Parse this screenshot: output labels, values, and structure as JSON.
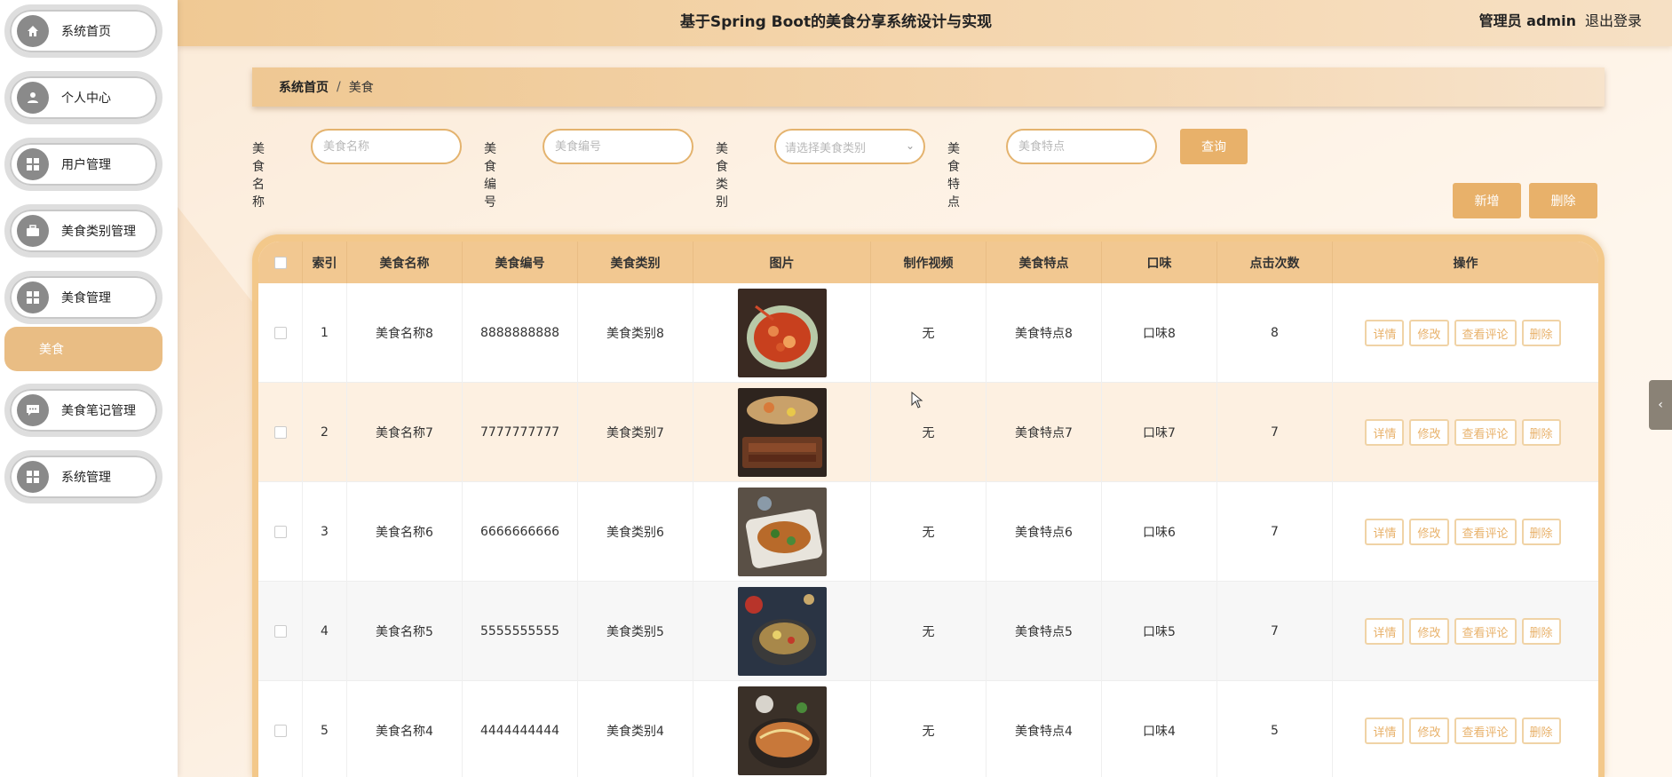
{
  "header": {
    "title": "基于Spring Boot的美食分享系统设计与实现",
    "user": "管理员 admin",
    "logout": "退出登录"
  },
  "sidebar": {
    "items": [
      {
        "label": "系统首页",
        "icon": "home-icon"
      },
      {
        "label": "个人中心",
        "icon": "user-icon"
      },
      {
        "label": "用户管理",
        "icon": "grid-icon"
      },
      {
        "label": "美食类别管理",
        "icon": "briefcase-icon"
      },
      {
        "label": "美食管理",
        "icon": "grid-icon"
      },
      {
        "label": "美食笔记管理",
        "icon": "chat-icon"
      },
      {
        "label": "系统管理",
        "icon": "grid-icon"
      }
    ],
    "active_sub": "美食"
  },
  "breadcrumb": {
    "home": "系统首页",
    "separator": "/",
    "current": "美食"
  },
  "search": {
    "name_label": "美食名称",
    "name_placeholder": "美食名称",
    "code_label": "美食编号",
    "code_placeholder": "美食编号",
    "type_label": "美食类别",
    "type_placeholder": "请选择美食类别",
    "feature_label": "美食特点",
    "feature_placeholder": "美食特点",
    "query_button": "查询"
  },
  "actions": {
    "add": "新增",
    "delete": "删除"
  },
  "table": {
    "columns": [
      "索引",
      "美食名称",
      "美食编号",
      "美食类别",
      "图片",
      "制作视频",
      "美食特点",
      "口味",
      "点击次数",
      "操作"
    ],
    "op_labels": {
      "detail": "详情",
      "edit": "修改",
      "comments": "查看评论",
      "delete": "删除"
    },
    "rows": [
      {
        "index": "1",
        "name": "美食名称8",
        "code": "8888888888",
        "type": "美食类别8",
        "video": "无",
        "feature": "美食特点8",
        "taste": "口味8",
        "clicks": "8"
      },
      {
        "index": "2",
        "name": "美食名称7",
        "code": "7777777777",
        "type": "美食类别7",
        "video": "无",
        "feature": "美食特点7",
        "taste": "口味7",
        "clicks": "7"
      },
      {
        "index": "3",
        "name": "美食名称6",
        "code": "6666666666",
        "type": "美食类别6",
        "video": "无",
        "feature": "美食特点6",
        "taste": "口味6",
        "clicks": "7"
      },
      {
        "index": "4",
        "name": "美食名称5",
        "code": "5555555555",
        "type": "美食类别5",
        "video": "无",
        "feature": "美食特点5",
        "taste": "口味5",
        "clicks": "7"
      },
      {
        "index": "5",
        "name": "美食名称4",
        "code": "4444444444",
        "type": "美食类别4",
        "video": "无",
        "feature": "美食特点4",
        "taste": "口味4",
        "clicks": "5"
      }
    ]
  },
  "colors": {
    "accent": "#e8b16a",
    "header": "#f0c994",
    "row_alt": "#fdf0e1"
  }
}
